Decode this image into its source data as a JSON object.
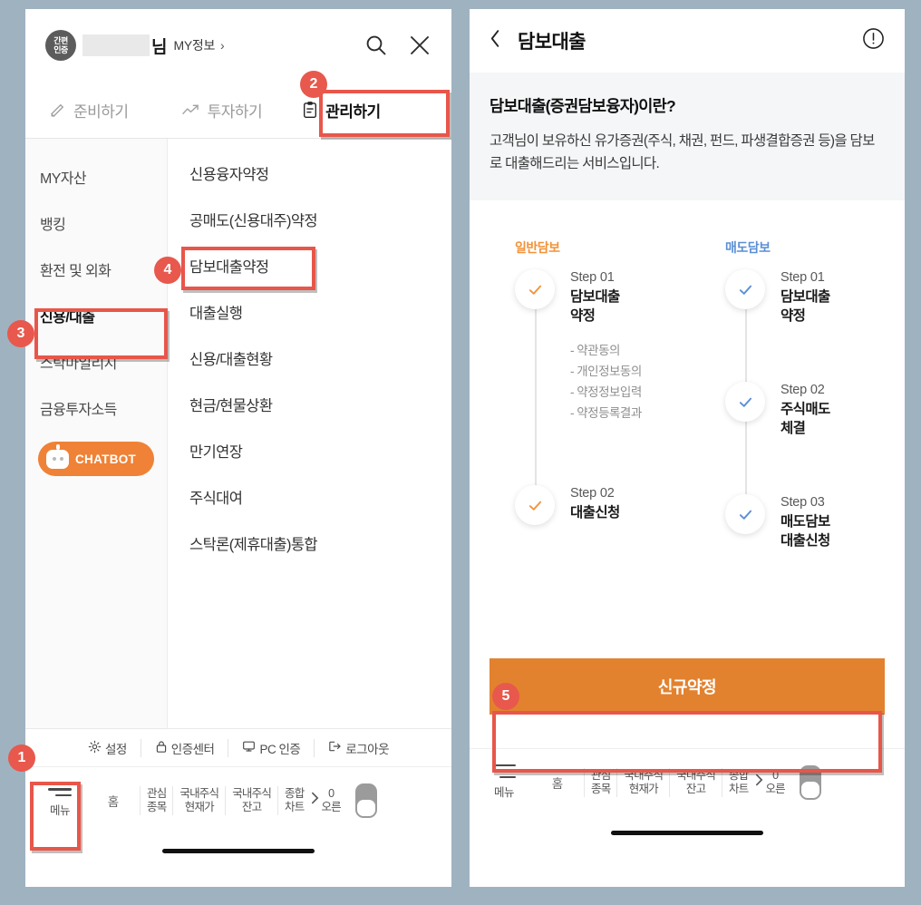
{
  "background_color": "#9fb2c0",
  "accent_orange": "#ef8236",
  "accent_blue": "#5b8fd6",
  "marker_red": "#e8584c",
  "left_phone": {
    "header": {
      "auth_badge_line1": "간편",
      "auth_badge_line2": "인증",
      "name_suffix": "님",
      "my_info": "MY정보",
      "chevron": "›",
      "search_icon": "search-icon",
      "close_icon": "close-icon"
    },
    "tabs": [
      {
        "label": "준비하기",
        "icon": "pencil-icon",
        "active": false
      },
      {
        "label": "투자하기",
        "icon": "trend-up-icon",
        "active": false
      },
      {
        "label": "관리하기",
        "icon": "clipboard-icon",
        "active": true
      }
    ],
    "sidebar": {
      "items": [
        {
          "label": "MY자산",
          "selected": false
        },
        {
          "label": "뱅킹",
          "selected": false
        },
        {
          "label": "환전 및 외화",
          "selected": false
        },
        {
          "label": "신용/대출",
          "selected": true
        },
        {
          "label": "스탁마일리지",
          "selected": false
        },
        {
          "label": "금융투자소득",
          "selected": false
        }
      ],
      "chatbot_label": "CHATBOT"
    },
    "menu_list": [
      {
        "label": "신용융자약정",
        "highlighted": false
      },
      {
        "label": "공매도(신용대주)약정",
        "highlighted": false
      },
      {
        "label": "담보대출약정",
        "highlighted": true
      },
      {
        "label": "대출실행",
        "highlighted": false
      },
      {
        "label": "신용/대출현황",
        "highlighted": false
      },
      {
        "label": "현금/현물상환",
        "highlighted": false
      },
      {
        "label": "만기연장",
        "highlighted": false
      },
      {
        "label": "주식대여",
        "highlighted": false
      },
      {
        "label": "스탁론(제휴대출)통합",
        "highlighted": false
      }
    ],
    "utility_bar": [
      {
        "label": "설정",
        "icon": "gear-icon"
      },
      {
        "label": "인증센터",
        "icon": "lock-icon"
      },
      {
        "label": "PC 인증",
        "icon": "monitor-icon"
      },
      {
        "label": "로그아웃",
        "icon": "logout-icon"
      }
    ],
    "bottom_nav": {
      "menu_label": "메뉴",
      "menu_icon": "hamburger-icon",
      "home_label": "홈",
      "items": [
        {
          "line1": "관심",
          "line2": "종목"
        },
        {
          "line1": "국내주식",
          "line2": "현재가"
        },
        {
          "line1": "국내주식",
          "line2": "잔고"
        },
        {
          "line1": "종합",
          "line2": "차트"
        }
      ],
      "more_line1": "0",
      "more_line2": "오른",
      "more_icon": "chevron-right-icon",
      "toggle_icon": "nav-toggle"
    }
  },
  "right_phone": {
    "header": {
      "back_icon": "chevron-left-icon",
      "title": "담보대출",
      "info_icon": "info-circle-icon"
    },
    "intro": {
      "heading": "담보대출(증권담보융자)이란?",
      "body": "고객님이 보유하신 유가증권(주식, 채권, 펀드, 파생결합증권 등)을 담보로 대출해드리는 서비스입니다."
    },
    "columns": [
      {
        "title": "일반담보",
        "color": "#f29239",
        "steps": [
          {
            "no": "Step 01",
            "name_line1": "담보대출",
            "name_line2": "약정",
            "check_icon": "check-icon",
            "sub_items": [
              "- 약관동의",
              "- 개인정보동의",
              "- 약정정보입력",
              "- 약정등록결과"
            ]
          },
          {
            "no": "Step 02",
            "name_line1": "대출신청",
            "name_line2": "",
            "check_icon": "check-icon",
            "sub_items": []
          }
        ]
      },
      {
        "title": "매도담보",
        "color": "#5b8fd6",
        "steps": [
          {
            "no": "Step 01",
            "name_line1": "담보대출",
            "name_line2": "약정",
            "check_icon": "check-icon",
            "sub_items": []
          },
          {
            "no": "Step 02",
            "name_line1": "주식매도",
            "name_line2": "체결",
            "check_icon": "check-icon",
            "sub_items": []
          },
          {
            "no": "Step 03",
            "name_line1": "매도담보",
            "name_line2": "대출신청",
            "check_icon": "check-icon",
            "sub_items": []
          }
        ]
      }
    ],
    "cta_label": "신규약정",
    "bottom_nav": {
      "menu_label": "메뉴",
      "menu_icon": "hamburger-icon",
      "home_label": "홈",
      "items": [
        {
          "line1": "관심",
          "line2": "종목"
        },
        {
          "line1": "국내주식",
          "line2": "현재가"
        },
        {
          "line1": "국내주식",
          "line2": "잔고"
        },
        {
          "line1": "종합",
          "line2": "차트"
        }
      ],
      "more_line1": "0",
      "more_line2": "오른",
      "more_icon": "chevron-right-icon",
      "toggle_icon": "nav-toggle"
    }
  },
  "annotations": {
    "markers": [
      {
        "number": "1",
        "target": "menu-button"
      },
      {
        "number": "2",
        "target": "tab-관리하기"
      },
      {
        "number": "3",
        "target": "sidebar-item-신용/대출"
      },
      {
        "number": "4",
        "target": "menu-item-담보대출약정"
      },
      {
        "number": "5",
        "target": "new-agreement-button"
      }
    ]
  }
}
